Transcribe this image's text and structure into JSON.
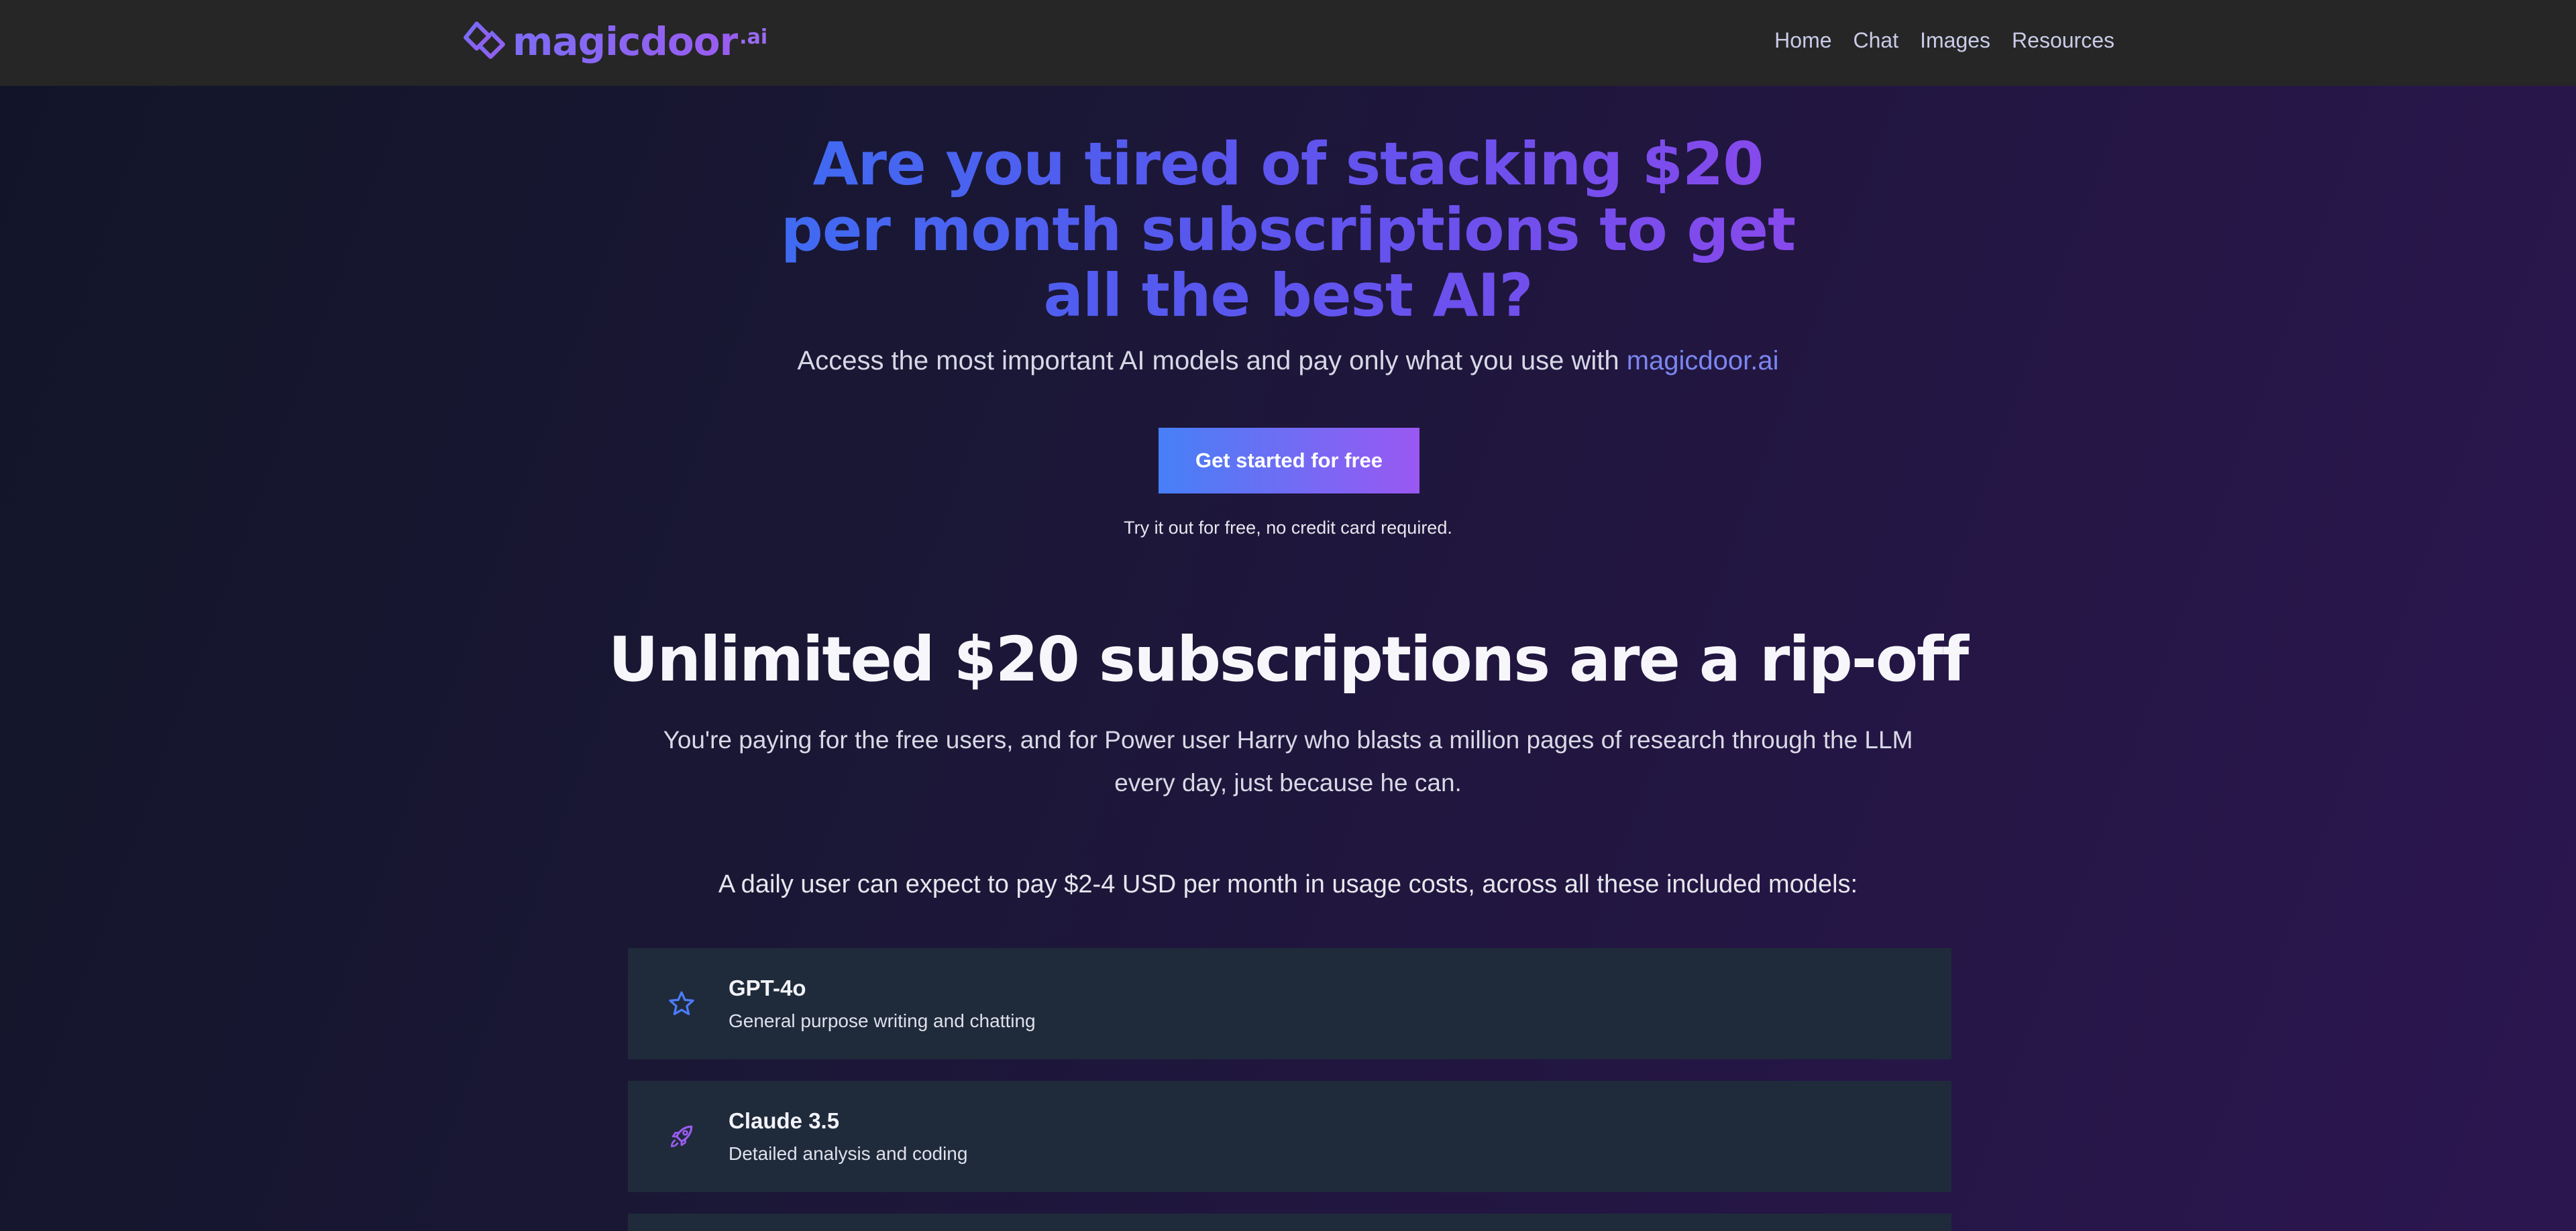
{
  "header": {
    "logo_text": "magicdoor",
    "logo_suffix": ".ai",
    "nav": [
      "Home",
      "Chat",
      "Images",
      "Resources"
    ]
  },
  "hero": {
    "title": "Are you tired of stacking $20 per month subscriptions to get all the best AI?",
    "subtitle_prefix": "Access the most important AI models and pay only what you use with ",
    "subtitle_brand": "magicdoor.ai",
    "cta_label": "Get started for free",
    "cta_note": "Try it out for free, no credit card required."
  },
  "section": {
    "title": "Unlimited $20 subscriptions are a rip-off",
    "body": "You're paying for the free users, and for Power user Harry who blasts a million pages of research through the LLM every day, just because he can.",
    "lead": "A daily user can expect to pay $2-4 USD per month in usage costs, across all these included models:"
  },
  "models": [
    {
      "name": "GPT-4o",
      "desc": "General purpose writing and chatting",
      "icon": "star-icon",
      "color": "#4a7cf5"
    },
    {
      "name": "Claude 3.5",
      "desc": "Detailed analysis and coding",
      "icon": "rocket-icon",
      "color": "#9b5cf0"
    }
  ],
  "colors": {
    "header_bg": "#262626",
    "card_bg": "#1f2a3b",
    "accent_blue": "#4680f6",
    "accent_purple": "#9a58f2"
  }
}
